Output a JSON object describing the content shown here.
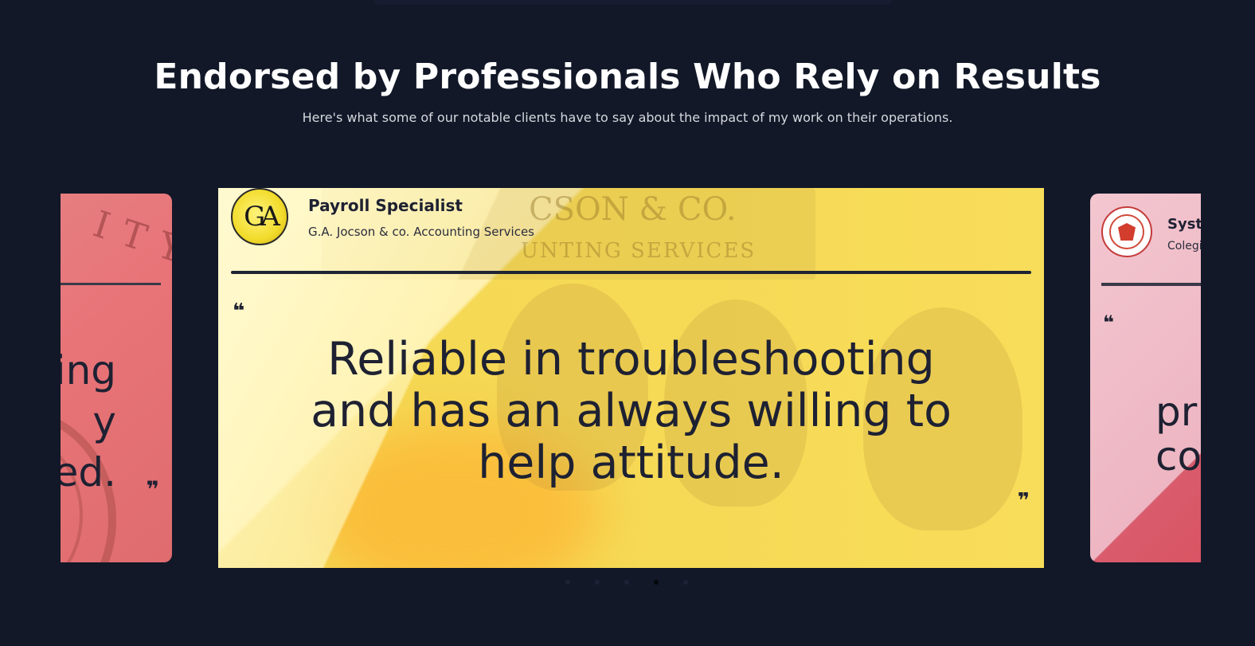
{
  "heading": "Endorsed by Professionals Who Rely on Results",
  "subheading": "Here's what some of our notable clients have to say about the impact of my work on their operations.",
  "testimonials": [
    {
      "position": "previous",
      "quote_fragment": "ing\ny\ned.",
      "bg_color": "#e87478"
    },
    {
      "position": "active",
      "title": "Payroll Specialist",
      "company": "G.A. Jocson & co. Accounting Services",
      "logo_text": "GA",
      "quote": "Reliable in troubleshooting and has an always willing to help attitude.",
      "open_quote": "❝",
      "close_quote": "❞",
      "bg_color": "#f8dd5a"
    },
    {
      "position": "next",
      "title_fragment": "Syste",
      "company_fragment": "Colegio",
      "quote_fragment": "pr\nco",
      "bg_color": "#f3c6d0"
    }
  ],
  "pagination": {
    "count": 5,
    "active_index": 3
  }
}
